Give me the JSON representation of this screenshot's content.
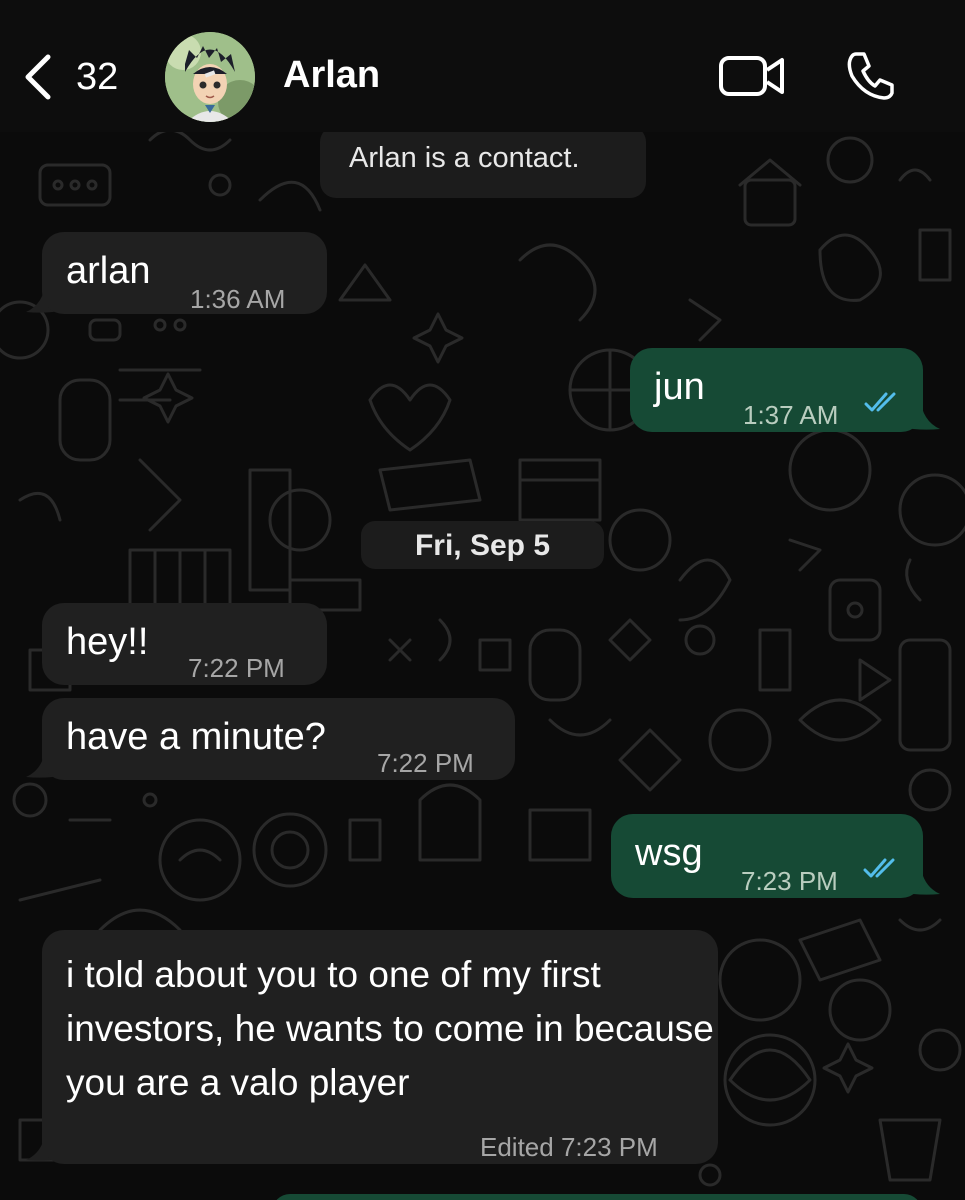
{
  "header": {
    "back_count": "32",
    "contact_name": "Arlan",
    "back_icon": "chevron-left-icon",
    "video_icon": "video-camera-icon",
    "call_icon": "phone-icon"
  },
  "system_notice": "Arlan is a contact.",
  "date_separator": "Fri, Sep 5",
  "messages": [
    {
      "direction": "incoming",
      "text": "arlan",
      "time": "1:36 AM"
    },
    {
      "direction": "outgoing",
      "text": "jun",
      "time": "1:37 AM",
      "status": "read"
    },
    {
      "direction": "incoming",
      "text": "hey!!",
      "time": "7:22 PM"
    },
    {
      "direction": "incoming",
      "text": "have a minute?",
      "time": "7:22 PM"
    },
    {
      "direction": "outgoing",
      "text": "wsg",
      "time": "7:23 PM",
      "status": "read"
    },
    {
      "direction": "incoming",
      "text": "i told about you to one of my first investors, he wants to come in because you are a valo player",
      "time": "Edited 7:23 PM"
    }
  ],
  "colors": {
    "incoming_bubble": "#202020",
    "outgoing_bubble": "#164a35",
    "read_ticks": "#53bdeb",
    "background": "#0b0b0b"
  }
}
